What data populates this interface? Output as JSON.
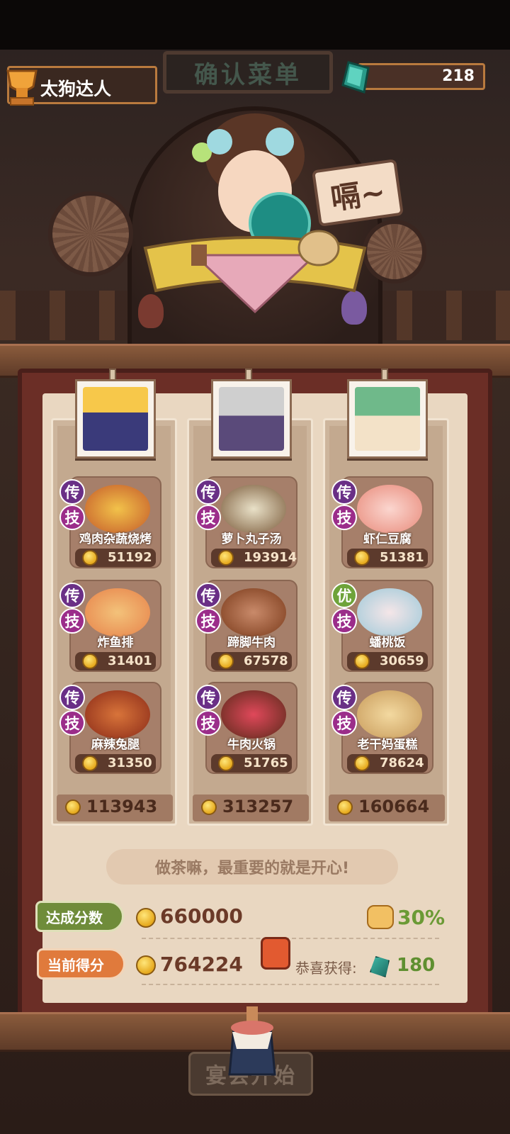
{
  "header": {
    "player_name": "太狗达人",
    "title": "确认菜单",
    "gem_count": "218"
  },
  "chef_bubble": "嗝~",
  "columns": [
    {
      "dishes": [
        {
          "name": "鸡肉杂蔬烧烤",
          "price": "51192",
          "badges": [
            "传",
            "技"
          ]
        },
        {
          "name": "炸鱼排",
          "price": "31401",
          "badges": [
            "传",
            "技"
          ]
        },
        {
          "name": "麻辣兔腿",
          "price": "31350",
          "badges": [
            "传",
            "技"
          ]
        }
      ],
      "total": "113943"
    },
    {
      "dishes": [
        {
          "name": "萝卜丸子汤",
          "price": "193914",
          "badges": [
            "传",
            "技"
          ]
        },
        {
          "name": "蹄脚牛肉",
          "price": "67578",
          "badges": [
            "传",
            "技"
          ]
        },
        {
          "name": "牛肉火锅",
          "price": "51765",
          "badges": [
            "传",
            "技"
          ]
        }
      ],
      "total": "313257"
    },
    {
      "dishes": [
        {
          "name": "虾仁豆腐",
          "price": "51381",
          "badges": [
            "传",
            "技"
          ]
        },
        {
          "name": "蟠桃饭",
          "price": "30659",
          "badges": [
            "优",
            "技"
          ]
        },
        {
          "name": "老干妈蛋糕",
          "price": "78624",
          "badges": [
            "传",
            "技"
          ]
        }
      ],
      "total": "160664"
    }
  ],
  "quote": "做茶嘛，最重要的就是开心!",
  "score": {
    "target_label": "达成分数",
    "target_value": "660000",
    "bonus_rate": "30%",
    "current_label": "当前得分",
    "current_value": "764224",
    "congrats_label": "恭喜获得:",
    "reward_gems": "180"
  },
  "start_button": "宴会开始",
  "colors": {
    "legend_badge": "#6a2f86",
    "skill_badge": "#9b2d8a",
    "good_badge": "#6ea33a",
    "target_tag": "#6f8c3a",
    "current_tag": "#e07a3c",
    "reward_green": "#5f8f30"
  }
}
